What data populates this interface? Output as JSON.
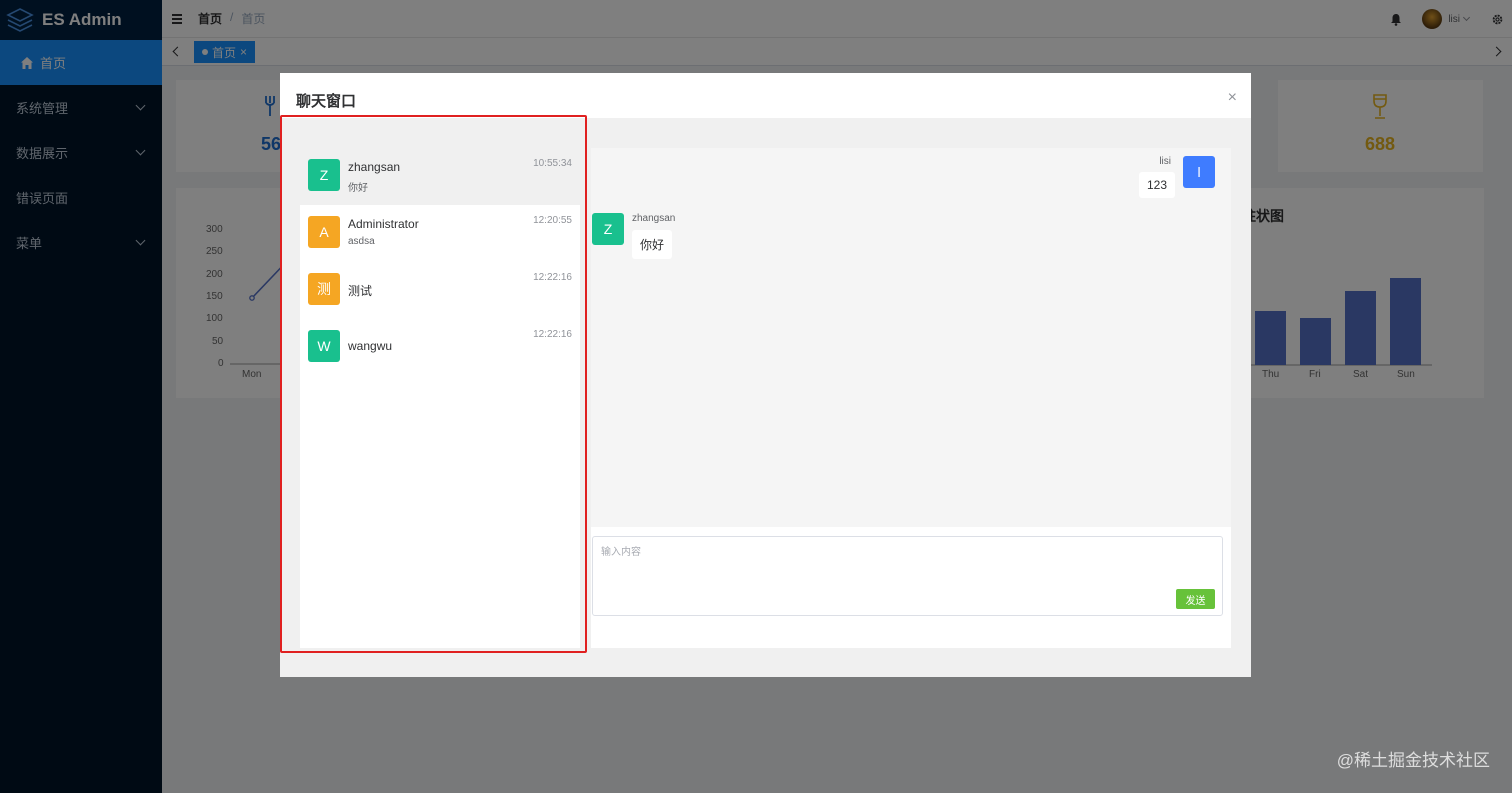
{
  "app": {
    "title": "ES Admin"
  },
  "sidebar": {
    "items": [
      {
        "label": "首页",
        "active": true,
        "icon": "home-icon"
      },
      {
        "label": "系统管理",
        "has_children": true
      },
      {
        "label": "数据展示",
        "has_children": true
      },
      {
        "label": "错误页面",
        "has_children": false
      },
      {
        "label": "菜单",
        "has_children": true
      }
    ]
  },
  "header": {
    "breadcrumb": [
      "首页",
      "/",
      "首页"
    ],
    "user_name": "lisi"
  },
  "tabs": [
    {
      "label": "首页"
    }
  ],
  "dashboard": {
    "stat_left": "56",
    "stat_right": "688",
    "line_chart_yticks": [
      "300",
      "250",
      "200",
      "150",
      "100",
      "50",
      "0"
    ],
    "line_chart_first_x": "Mon",
    "bar_chart_title": "柱状图",
    "bar_chart_x": [
      "Thu",
      "Fri",
      "Sat",
      "Sun"
    ]
  },
  "dialog": {
    "title": "聊天窗口",
    "contacts": [
      {
        "initial": "Z",
        "name": "zhangsan",
        "last_msg": "你好",
        "time": "10:55:34",
        "color": "#19c08e",
        "active": true
      },
      {
        "initial": "A",
        "name": "Administrator",
        "last_msg": "asdsa",
        "time": "12:20:55",
        "color": "#f5a623"
      },
      {
        "initial": "测",
        "name": "测试",
        "last_msg": "",
        "time": "12:22:16",
        "color": "#f5a623"
      },
      {
        "initial": "W",
        "name": "wangwu",
        "last_msg": "",
        "time": "12:22:16",
        "color": "#19c08e"
      }
    ],
    "messages": [
      {
        "side": "right",
        "initial": "l",
        "name": "lisi",
        "text": "123",
        "color": "#3f7cff"
      },
      {
        "side": "left",
        "initial": "Z",
        "name": "zhangsan",
        "text": "你好",
        "color": "#19c08e"
      }
    ],
    "input_placeholder": "输入内容",
    "send_label": "发送"
  },
  "watermark": "@稀土掘金技术社区"
}
